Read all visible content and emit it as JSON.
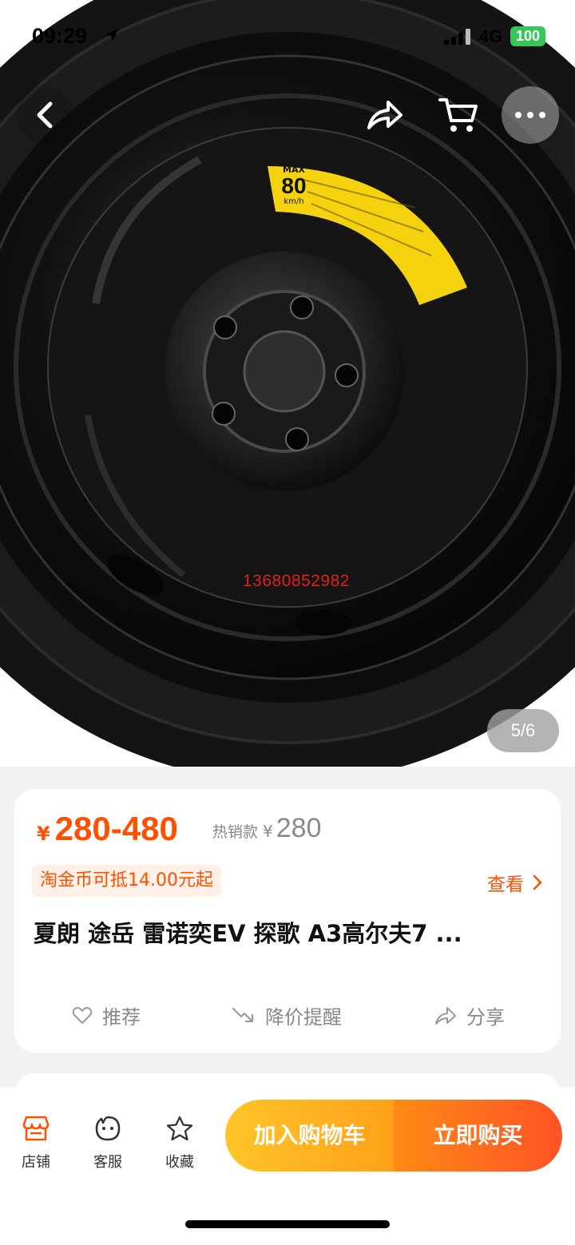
{
  "status_bar": {
    "time": "09:29",
    "network": "4G",
    "battery": "100",
    "battery_color": "#37c759"
  },
  "nav": {
    "back_icon": "chevron-left-icon",
    "share_icon": "share-icon",
    "cart_icon": "cart-icon",
    "more_icon": "more-icon"
  },
  "gallery": {
    "pager": "5/6",
    "watermark_phone": "13680852982",
    "sticker": {
      "max": "MAX",
      "speed": "80",
      "unit": "km/h"
    }
  },
  "product": {
    "currency": "¥",
    "price_range": "280-480",
    "hot_label": "热销款",
    "hot_currency": "¥",
    "hot_price": "280",
    "coin_text": "淘金币可抵14.00元起",
    "see_label": "查看",
    "title": "夏朗 途岳 雷诺奕EV 探歌 A3高尔夫7 ...",
    "accent_color": "#ff5000"
  },
  "actions": {
    "recommend": "推荐",
    "price_drop": "降价提醒",
    "share": "分享"
  },
  "bottom_bar": {
    "store": "店铺",
    "service": "客服",
    "favorite": "收藏",
    "add_cart": "加入购物车",
    "buy_now": "立即购买"
  }
}
